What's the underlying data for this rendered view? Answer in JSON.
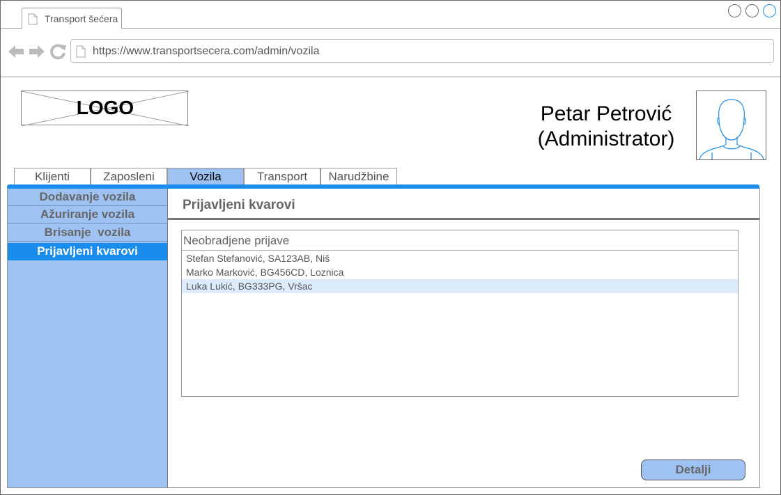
{
  "browser": {
    "tab_title": "Transport šećera",
    "url": "https://www.transportsecera.com/admin/vozila"
  },
  "header": {
    "logo_text": "LOGO",
    "user_name_line1": "Petar Petrović",
    "user_name_line2": "(Administrator)"
  },
  "nav": {
    "tabs": [
      {
        "label": "Klijenti",
        "active": false
      },
      {
        "label": "Zaposleni",
        "active": false
      },
      {
        "label": "Vozila",
        "active": true
      },
      {
        "label": "Transport",
        "active": false
      },
      {
        "label": "Narudžbine",
        "active": false
      }
    ]
  },
  "sidebar": {
    "items": [
      {
        "label": "Dodavanje vozila",
        "active": false
      },
      {
        "label": "Ažuriranje vozila",
        "active": false
      },
      {
        "label": "Brisanje  vozila",
        "active": false
      },
      {
        "label": "Prijavljeni kvarovi",
        "active": true
      }
    ]
  },
  "main": {
    "title": "Prijavljeni kvarovi",
    "list_header": "Neobradjene prijave",
    "rows": [
      "Stefan Stefanović, SA123AB, Niš",
      "Marko Marković, BG456CD, Loznica",
      "Luka Lukić, BG333PG, Vršac"
    ],
    "selected_row": 2,
    "details_button": "Detalji"
  },
  "colors": {
    "accent": "#1a8cec",
    "sidebar_bg": "#9ec2f2",
    "selected_row": "#dcecfd"
  }
}
